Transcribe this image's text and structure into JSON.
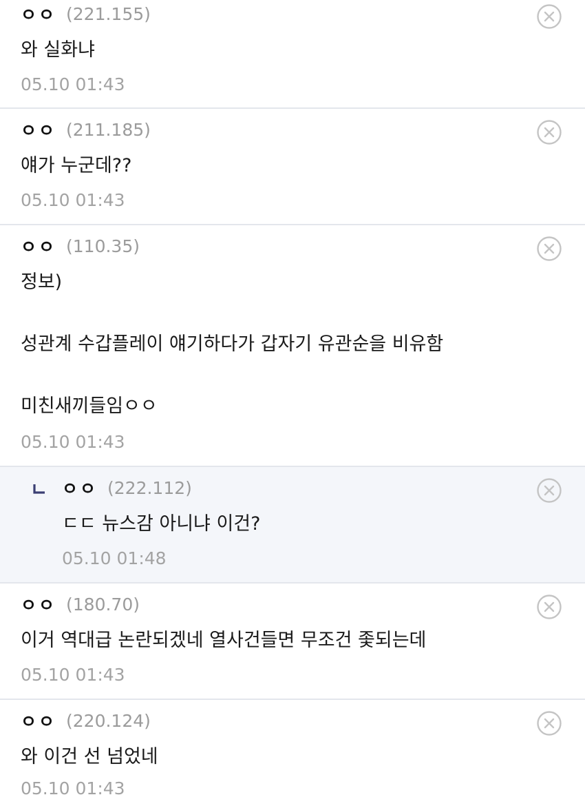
{
  "comments": [
    {
      "nickname": "ㅇㅇ",
      "ip": "(221.155)",
      "text": "와 실화냐",
      "time": "05.10 01:43",
      "reply": false
    },
    {
      "nickname": "ㅇㅇ",
      "ip": "(211.185)",
      "text": "얘가 누군데??",
      "time": "05.10 01:43",
      "reply": false
    },
    {
      "nickname": "ㅇㅇ",
      "ip": "(110.35)",
      "text": "정보)\n\n성관계 수갑플레이 얘기하다가 갑자기 유관순을 비유함\n\n미친새끼들임ㅇㅇ",
      "time": "05.10 01:43",
      "reply": false
    },
    {
      "nickname": "ㅇㅇ",
      "ip": "(222.112)",
      "text": "ㄷㄷ 뉴스감 아니냐 이건?",
      "time": "05.10 01:48",
      "reply": true
    },
    {
      "nickname": "ㅇㅇ",
      "ip": "(180.70)",
      "text": "이거 역대급 논란되겠네 열사건들면 무조건 좇되는데",
      "time": "05.10 01:43",
      "reply": false
    },
    {
      "nickname": "ㅇㅇ",
      "ip": "(220.124)",
      "text": "와 이건 선 넘었네",
      "time": "05.10 01:43",
      "reply": false
    }
  ],
  "icons": {
    "delete": "close-circle-icon",
    "reply": "reply-arrow-icon"
  },
  "colors": {
    "reply_background": "#f4f6fa",
    "reply_arrow": "#3b3f73",
    "meta_gray": "#9b9b9b",
    "divider": "#e3e6ec"
  }
}
